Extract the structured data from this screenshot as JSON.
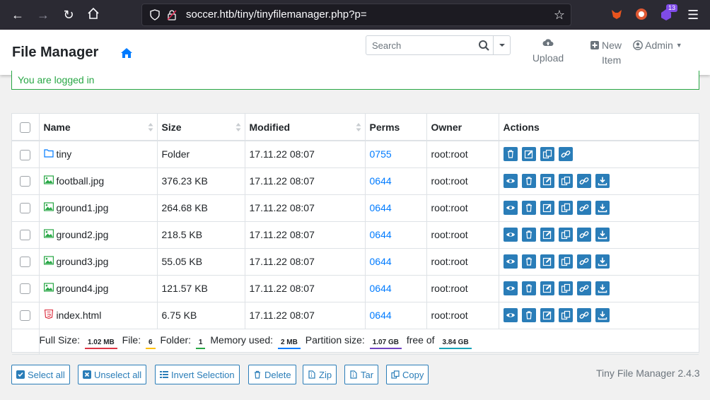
{
  "browser": {
    "url": "soccer.htb/tiny/tinyfilemanager.php?p=",
    "extension_badge": "13"
  },
  "header": {
    "brand": "File Manager",
    "search_placeholder": "Search",
    "upload_label": "Upload",
    "new_label_1": "New",
    "new_label_2": "Item",
    "admin_label": "Admin"
  },
  "alert": {
    "message": "You are logged in"
  },
  "table": {
    "columns": {
      "name": "Name",
      "size": "Size",
      "modified": "Modified",
      "perms": "Perms",
      "owner": "Owner",
      "actions": "Actions"
    },
    "rows": [
      {
        "name": "tiny",
        "icon": "folder-icon",
        "size": "Folder",
        "modified": "17.11.22 08:07",
        "perms": "0755",
        "owner": "root:root"
      },
      {
        "name": "football.jpg",
        "icon": "image-icon",
        "size": "376.23 KB",
        "modified": "17.11.22 08:07",
        "perms": "0644",
        "owner": "root:root"
      },
      {
        "name": "ground1.jpg",
        "icon": "image-icon",
        "size": "264.68 KB",
        "modified": "17.11.22 08:07",
        "perms": "0644",
        "owner": "root:root"
      },
      {
        "name": "ground2.jpg",
        "icon": "image-icon",
        "size": "218.5 KB",
        "modified": "17.11.22 08:07",
        "perms": "0644",
        "owner": "root:root"
      },
      {
        "name": "ground3.jpg",
        "icon": "image-icon",
        "size": "55.05 KB",
        "modified": "17.11.22 08:07",
        "perms": "0644",
        "owner": "root:root"
      },
      {
        "name": "ground4.jpg",
        "icon": "image-icon",
        "size": "121.57 KB",
        "modified": "17.11.22 08:07",
        "perms": "0644",
        "owner": "root:root"
      },
      {
        "name": "index.html",
        "icon": "html5-icon",
        "size": "6.75 KB",
        "modified": "17.11.22 08:07",
        "perms": "0644",
        "owner": "root:root"
      }
    ],
    "footer": {
      "full_size_label": "Full Size:",
      "full_size": "1.02 MB",
      "file_label": "File:",
      "file_count": "6",
      "folder_label": "Folder:",
      "folder_count": "1",
      "memory_label": "Memory used:",
      "memory": "2 MB",
      "partition_label": "Partition size:",
      "partition": "1.07 GB",
      "free_of_label": "free of",
      "total": "3.84 GB"
    }
  },
  "buttons": {
    "select_all": "Select all",
    "unselect_all": "Unselect all",
    "invert": "Invert Selection",
    "delete": "Delete",
    "zip": "Zip",
    "tar": "Tar",
    "copy": "Copy"
  },
  "version": "Tiny File Manager 2.4.3",
  "colors": {
    "accent": "#2a7db8",
    "link": "#007bff",
    "success": "#28a745"
  }
}
